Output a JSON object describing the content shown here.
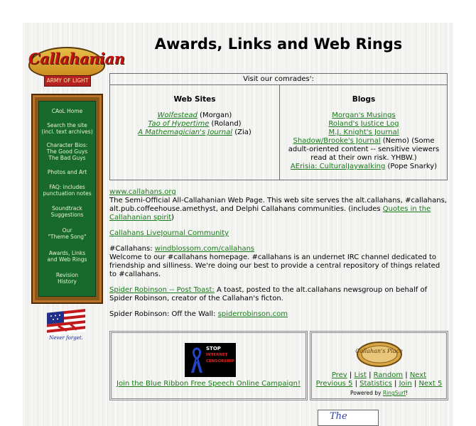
{
  "logo": {
    "text": "Callahanian",
    "ribbon": "ARMY OF LIGHT"
  },
  "sidebar": {
    "items": [
      {
        "label": "CAoL Home"
      },
      {
        "label": "Search the site\n(incl. text archives)"
      },
      {
        "label": "Character Bios:\nThe Good Guys\nThe Bad Guys"
      },
      {
        "label": "Photos and Art"
      },
      {
        "label": "FAQ: includes\npunctuation notes"
      },
      {
        "label": "Soundtrack\nSuggestions"
      },
      {
        "label": "Our\n\"Theme Song\""
      },
      {
        "label": "Awards, Links\nand Web Rings"
      },
      {
        "label": "Revision\nHistory"
      }
    ]
  },
  "flag": {
    "caption": "Never forget."
  },
  "page": {
    "title": "Awards, Links and Web Rings"
  },
  "comrades": {
    "header": "Visit our comrades':",
    "websites_heading": "Web Sites",
    "websites": [
      {
        "link": "Wolfestead",
        "suffix": " (Morgan)"
      },
      {
        "link": "Tao of Hypertime",
        "suffix": " (Roland)"
      },
      {
        "link": "A Mathemagician's Journal",
        "suffix": " (Zia)"
      }
    ],
    "blogs_heading": "Blogs",
    "blogs": {
      "b1": "Morgan's Musings",
      "b2": "Roland's Justice Log",
      "b3": "M.J. Knight's Journal",
      "b4_link": "Shadow/Brooke's Journal",
      "b4_text1": " (Nemo) (Some",
      "b4_text2": "adult-oriented content -- sensitive viewers",
      "b4_text3": "read at their own risk. YHBW.)",
      "b5_link": "AErisia: CulturalJaywalking",
      "b5_text": " (Pope Snarky)"
    }
  },
  "links": {
    "p1_link": "www.callahans.org",
    "p1_text": "The Semi-Official All-Callahanian Web Page. This web site serves the alt.callahans, #callahans, alt.pub.coffeehouse.amethyst, and Delphi Callahans communities. (includes ",
    "p1_link2": "Quotes in the Callahanian spirit",
    "p1_end": ")",
    "p2_link": "Callahans LiveJournal Community",
    "p3_prefix": "#Callahans: ",
    "p3_link": "windblossom.com/callahans",
    "p3_text": "Welcome to our #callahans homepage. #callahans is an undernet IRC channel dedicated to friendship and silliness. We're doing our best to provide a central repository of things related to #callahans.",
    "p4_link": "Spider Robinson -- Post Toast:",
    "p4_text": " A toast, posted to the alt.callahans newsgroup on behalf of Spider Robinson, creator of the Callahan's ficton.",
    "p5_prefix": "Spider Robinson: Off the Wall: ",
    "p5_link": "spiderrobinson.com"
  },
  "campaign": {
    "stop_line1": "STOP",
    "stop_line2": "INTERNET",
    "stop_line3": "CENSORSHIP",
    "join_link": "Join the Blue Ribbon Free Speech Online Campaign!"
  },
  "webring": {
    "logo_text": "Callahan's Place",
    "prev": "Prev",
    "list": "List",
    "random": "Random",
    "next": "Next",
    "previous5": "Previous 5",
    "statistics": "Statistics",
    "join": "Join",
    "next5": "Next 5",
    "powered_prefix": "Powered by ",
    "powered_link": "RingSurf",
    "powered_suffix": "!",
    "sep": " | "
  },
  "bottom_image": {
    "text": "The"
  },
  "colors": {
    "link": "#1a7a1a",
    "sidebar_green": "#17692c",
    "frame_brown": "#8a5518"
  }
}
